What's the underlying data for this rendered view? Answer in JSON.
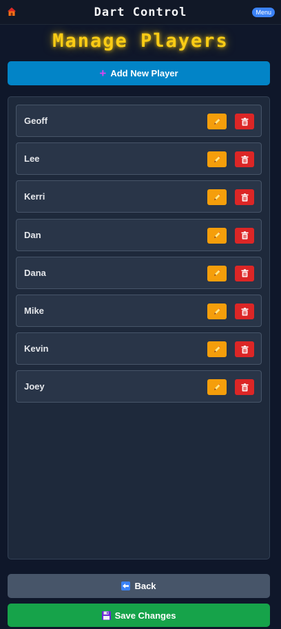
{
  "header": {
    "home_icon": "home-icon",
    "title": "Dart Control",
    "menu_label": "Menu"
  },
  "page": {
    "title": "Manage Players"
  },
  "add_button": {
    "icon": "plus-icon",
    "label": "Add New Player"
  },
  "players": [
    {
      "name": "Geoff"
    },
    {
      "name": "Lee"
    },
    {
      "name": "Kerri"
    },
    {
      "name": "Dan"
    },
    {
      "name": "Dana"
    },
    {
      "name": "Mike"
    },
    {
      "name": "Kevin"
    },
    {
      "name": "Joey"
    }
  ],
  "row_actions": {
    "edit_icon": "pencil-icon",
    "delete_icon": "trash-icon"
  },
  "footer": {
    "back_icon": "back-arrow-icon",
    "back_label": "Back",
    "save_icon": "floppy-disk-icon",
    "save_label": "Save Changes"
  },
  "colors": {
    "background": "#0f172a",
    "title_glow": "#facc15",
    "add_button": "#0284c7",
    "edit_button": "#f59e0b",
    "delete_button": "#dc2626",
    "back_button": "#475569",
    "save_button": "#16a34a",
    "menu_pill": "#3b82f6"
  }
}
